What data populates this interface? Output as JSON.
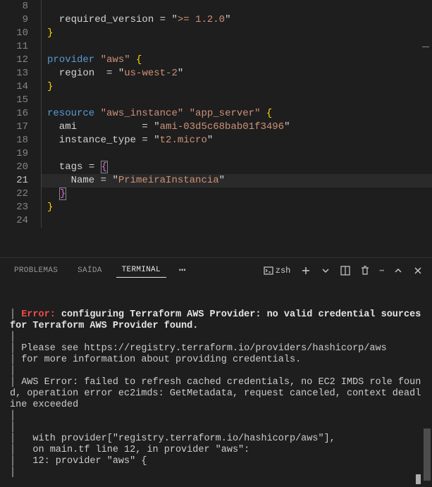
{
  "editor": {
    "lines": [
      {
        "n": 8,
        "tokens": []
      },
      {
        "n": 9,
        "tokens": [
          {
            "t": "  required_version ",
            "c": "t-id"
          },
          {
            "t": "=",
            "c": "t-op"
          },
          {
            "t": " ",
            "c": ""
          },
          {
            "t": "\"",
            "c": "t-punct"
          },
          {
            "t": ">= 1.2.0",
            "c": "t-str"
          },
          {
            "t": "\"",
            "c": "t-punct"
          }
        ]
      },
      {
        "n": 10,
        "tokens": [
          {
            "t": "}",
            "c": "t-br"
          }
        ]
      },
      {
        "n": 11,
        "tokens": []
      },
      {
        "n": 12,
        "tokens": [
          {
            "t": "provider",
            "c": "t-key"
          },
          {
            "t": " ",
            "c": ""
          },
          {
            "t": "\"aws\"",
            "c": "t-str"
          },
          {
            "t": " ",
            "c": ""
          },
          {
            "t": "{",
            "c": "t-br"
          }
        ]
      },
      {
        "n": 13,
        "tokens": [
          {
            "t": "  region  ",
            "c": "t-id"
          },
          {
            "t": "=",
            "c": "t-op"
          },
          {
            "t": " ",
            "c": ""
          },
          {
            "t": "\"",
            "c": "t-punct"
          },
          {
            "t": "us-west-2",
            "c": "t-str"
          },
          {
            "t": "\"",
            "c": "t-punct"
          }
        ]
      },
      {
        "n": 14,
        "tokens": [
          {
            "t": "}",
            "c": "t-br"
          }
        ]
      },
      {
        "n": 15,
        "tokens": []
      },
      {
        "n": 16,
        "tokens": [
          {
            "t": "resource",
            "c": "t-key"
          },
          {
            "t": " ",
            "c": ""
          },
          {
            "t": "\"aws_instance\"",
            "c": "t-str"
          },
          {
            "t": " ",
            "c": ""
          },
          {
            "t": "\"app_server\"",
            "c": "t-str"
          },
          {
            "t": " ",
            "c": ""
          },
          {
            "t": "{",
            "c": "t-br"
          }
        ]
      },
      {
        "n": 17,
        "tokens": [
          {
            "t": "  ami           ",
            "c": "t-id"
          },
          {
            "t": "=",
            "c": "t-op"
          },
          {
            "t": " ",
            "c": ""
          },
          {
            "t": "\"",
            "c": "t-punct"
          },
          {
            "t": "ami-03d5c68bab01f3496",
            "c": "t-str"
          },
          {
            "t": "\"",
            "c": "t-punct"
          }
        ]
      },
      {
        "n": 18,
        "tokens": [
          {
            "t": "  instance_type ",
            "c": "t-id"
          },
          {
            "t": "=",
            "c": "t-op"
          },
          {
            "t": " ",
            "c": ""
          },
          {
            "t": "\"",
            "c": "t-punct"
          },
          {
            "t": "t2.micro",
            "c": "t-str"
          },
          {
            "t": "\"",
            "c": "t-punct"
          }
        ]
      },
      {
        "n": 19,
        "tokens": []
      },
      {
        "n": 20,
        "tokens": [
          {
            "t": "  tags ",
            "c": "t-id"
          },
          {
            "t": "=",
            "c": "t-op"
          },
          {
            "t": " ",
            "c": ""
          },
          {
            "t": "{",
            "c": "t-br2",
            "box": true
          }
        ]
      },
      {
        "n": 21,
        "hl": true,
        "tokens": [
          {
            "t": "    Name ",
            "c": "t-id"
          },
          {
            "t": "=",
            "c": "t-op"
          },
          {
            "t": " ",
            "c": ""
          },
          {
            "t": "\"",
            "c": "t-punct"
          },
          {
            "t": "PrimeiraInstancia",
            "c": "t-str"
          },
          {
            "t": "\"",
            "c": "t-punct"
          }
        ]
      },
      {
        "n": 22,
        "tokens": [
          {
            "t": "  ",
            "c": ""
          },
          {
            "t": "}",
            "c": "t-br2",
            "box": true
          }
        ]
      },
      {
        "n": 23,
        "tokens": [
          {
            "t": "}",
            "c": "t-br"
          }
        ]
      },
      {
        "n": 24,
        "tokens": []
      }
    ]
  },
  "panel": {
    "tabs": [
      {
        "label": "PROBLEMAS",
        "active": false
      },
      {
        "label": "SAÍDA",
        "active": false
      },
      {
        "label": "TERMINAL",
        "active": true
      }
    ],
    "more": "⋯",
    "shell": "zsh"
  },
  "terminal": {
    "lines": [
      {
        "parts": [
          {
            "t": "│ ",
            "c": ""
          },
          {
            "t": "Error:",
            "c": "err-bold"
          },
          {
            "t": " ",
            "c": ""
          },
          {
            "t": "configuring Terraform AWS Provider: no valid credential sources for Terraform AWS Provider found.",
            "c": "msg-bold"
          }
        ]
      },
      {
        "parts": [
          {
            "t": "│ ",
            "c": ""
          }
        ]
      },
      {
        "parts": [
          {
            "t": "│ Please see https://registry.terraform.io/providers/hashicorp/aws",
            "c": ""
          }
        ]
      },
      {
        "parts": [
          {
            "t": "│ for more information about providing credentials.",
            "c": ""
          }
        ]
      },
      {
        "parts": [
          {
            "t": "│ ",
            "c": ""
          }
        ]
      },
      {
        "parts": [
          {
            "t": "│ AWS Error: failed to refresh cached credentials, no EC2 IMDS role found, operation error ec2imds: GetMetadata, request canceled, context deadline exceeded",
            "c": ""
          }
        ]
      },
      {
        "parts": [
          {
            "t": "│ ",
            "c": ""
          }
        ]
      },
      {
        "parts": [
          {
            "t": "│ ",
            "c": ""
          }
        ]
      },
      {
        "parts": [
          {
            "t": "│   with provider[\"registry.terraform.io/hashicorp/aws\"],",
            "c": ""
          }
        ]
      },
      {
        "parts": [
          {
            "t": "│   on main.tf line 12, in provider \"aws\":",
            "c": ""
          }
        ]
      },
      {
        "parts": [
          {
            "t": "│   12: provider \"aws\" {",
            "c": ""
          }
        ]
      },
      {
        "parts": [
          {
            "t": "│ ",
            "c": ""
          }
        ]
      }
    ]
  }
}
